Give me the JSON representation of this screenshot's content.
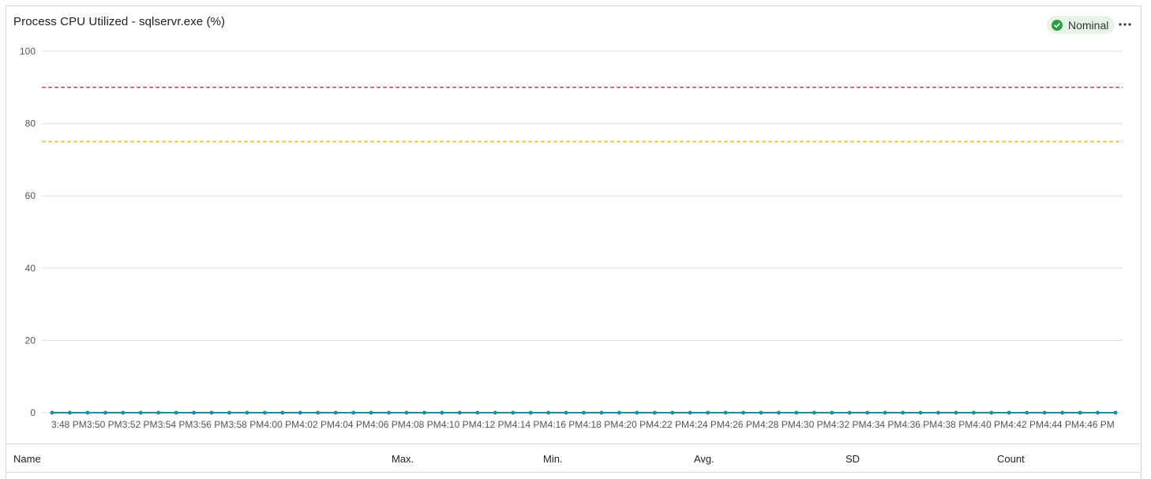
{
  "header": {
    "title": "Process CPU Utilized - sqlservr.exe (%)",
    "status_label": "Nominal",
    "status_color": "#2e9e44",
    "status_bg": "#e7f3e7",
    "more_icon": "more-horizontal-icon",
    "status_icon": "check-circle-icon"
  },
  "chart_data": {
    "type": "line",
    "title": "Process CPU Utilized - sqlservr.exe (%)",
    "ylim": [
      0,
      100
    ],
    "yticks": [
      0,
      20,
      40,
      60,
      80,
      100
    ],
    "grid": true,
    "x_tick_labels": [
      "3:48 PM",
      "3:50 PM",
      "3:52 PM",
      "3:54 PM",
      "3:56 PM",
      "3:58 PM",
      "4:00 PM",
      "4:02 PM",
      "4:04 PM",
      "4:06 PM",
      "4:08 PM",
      "4:10 PM",
      "4:12 PM",
      "4:14 PM",
      "4:16 PM",
      "4:18 PM",
      "4:20 PM",
      "4:22 PM",
      "4:24 PM",
      "4:26 PM",
      "4:28 PM",
      "4:30 PM",
      "4:32 PM",
      "4:34 PM",
      "4:36 PM",
      "4:38 PM",
      "4:40 PM",
      "4:42 PM",
      "4:44 PM",
      "4:46 PM"
    ],
    "x_start": "3:48 PM",
    "x_step_minutes": 1,
    "series": [
      {
        "color": "#1a8fa8",
        "values": [
          0,
          0,
          0,
          0,
          0,
          0,
          0,
          0,
          0,
          0,
          0,
          0,
          0,
          0,
          0,
          0,
          0,
          0,
          0,
          0,
          0,
          0,
          0,
          0,
          0,
          0,
          0,
          0,
          0,
          0,
          0,
          0,
          0,
          0,
          0,
          0,
          0,
          0,
          0,
          0,
          0,
          0,
          0,
          0,
          0,
          0,
          0,
          0,
          0,
          0,
          0,
          0,
          0,
          0,
          0,
          0,
          0,
          0,
          0,
          0,
          0
        ]
      }
    ],
    "thresholds": [
      {
        "value": 90,
        "color": "#e0474c",
        "style": "dashed"
      },
      {
        "value": 75,
        "color": "#e8c11c",
        "style": "dashed"
      }
    ]
  },
  "stats_table": {
    "columns": [
      "Name",
      "Max.",
      "Min.",
      "Avg.",
      "SD",
      "Count"
    ]
  }
}
